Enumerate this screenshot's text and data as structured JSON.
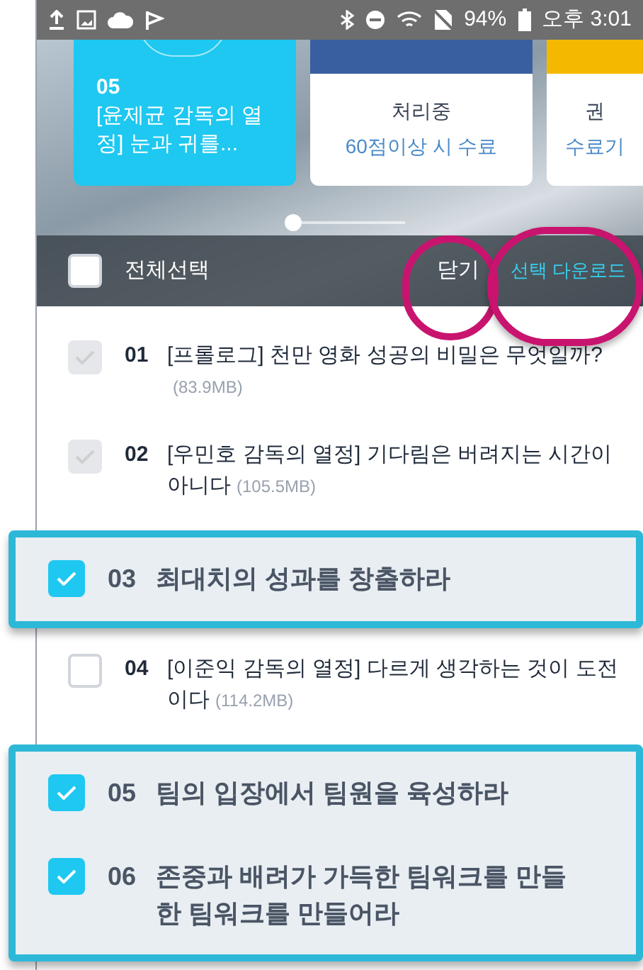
{
  "status_bar": {
    "battery": "94%",
    "time": "오후 3:01"
  },
  "cards": [
    {
      "kind": "lesson",
      "number": "05",
      "title": "[윤제균 감독의 열정] 눈과 귀를..."
    },
    {
      "kind": "status",
      "color": "#3a5fa0",
      "label": "처리중",
      "sub": "60점이상 시 수료"
    },
    {
      "kind": "status",
      "color": "#f5b800",
      "label": "권",
      "sub": "수료기"
    }
  ],
  "toolbar": {
    "select_all": {
      "label": "전체선택",
      "checked": false
    },
    "close": "닫기",
    "download": "선택 다운로드"
  },
  "list": [
    {
      "highlighted": false,
      "items": [
        {
          "number": "01",
          "title": "[프롤로그] 천만 영화 성공의 비밀은 무엇일까?",
          "size": "(83.9MB)",
          "checked": true,
          "disabled": true
        },
        {
          "number": "02",
          "title": "[우민호 감독의 열정] 기다림은 버려지는 시간이 아니다",
          "size": "(105.5MB)",
          "checked": true,
          "disabled": true
        }
      ]
    },
    {
      "highlighted": true,
      "items": [
        {
          "number": "03",
          "title": "최대치의 성과를 창출하라",
          "checked": true,
          "disabled": false
        }
      ]
    },
    {
      "highlighted": false,
      "items": [
        {
          "number": "04",
          "title": "[이준익 감독의 열정] 다르게 생각하는 것이 도전이다",
          "size": "(114.2MB)",
          "checked": false,
          "disabled": false
        }
      ]
    },
    {
      "highlighted": true,
      "items": [
        {
          "number": "05",
          "title": "팀의 입장에서 팀원을 육성하라",
          "checked": true,
          "disabled": false
        },
        {
          "number": "06",
          "title": "존중과 배려가 가득한 팀워크를 만들 한 팀워크를 만들어라",
          "checked": true,
          "disabled": false
        }
      ]
    }
  ]
}
